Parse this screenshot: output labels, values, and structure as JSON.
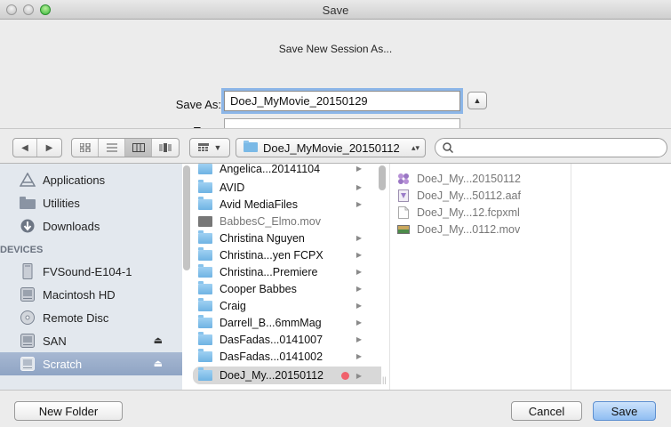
{
  "window": {
    "title": "Save"
  },
  "dialog": {
    "subtitle": "Save New Session As...",
    "save_as_label": "Save As:",
    "save_as_value": "DoeJ_MyMovie_20150129",
    "tags_label": "Tags:",
    "tags_value": ""
  },
  "toolbar": {
    "current_folder": "DoeJ_MyMovie_20150112",
    "search_placeholder": "",
    "active_view": "columns"
  },
  "sidebar": {
    "items_top": [
      {
        "label": "Applications",
        "icon": "applications-icon"
      },
      {
        "label": "Utilities",
        "icon": "folder-icon"
      },
      {
        "label": "Downloads",
        "icon": "downloads-icon"
      }
    ],
    "devices_heading": "DEVICES",
    "devices": [
      {
        "label": "FVSound-E104-1",
        "icon": "computer-icon",
        "eject": false
      },
      {
        "label": "Macintosh HD",
        "icon": "hard-drive-icon",
        "eject": false
      },
      {
        "label": "Remote Disc",
        "icon": "disc-icon",
        "eject": false
      },
      {
        "label": "SAN",
        "icon": "drive-icon",
        "eject": true
      },
      {
        "label": "Scratch",
        "icon": "drive-icon",
        "eject": true,
        "selected": true
      }
    ]
  },
  "column1": {
    "rows": [
      {
        "label": "Angelica...20141104",
        "type": "folder",
        "arrow": true
      },
      {
        "label": "AVID",
        "type": "folder",
        "arrow": true
      },
      {
        "label": "Avid MediaFiles",
        "type": "folder",
        "arrow": true
      },
      {
        "label": "BabbesC_Elmo.mov",
        "type": "file",
        "arrow": false
      },
      {
        "label": "Christina Nguyen",
        "type": "folder",
        "arrow": true
      },
      {
        "label": "Christina...yen FCPX",
        "type": "folder",
        "arrow": true
      },
      {
        "label": "Christina...Premiere",
        "type": "folder",
        "arrow": true
      },
      {
        "label": "Cooper Babbes",
        "type": "folder",
        "arrow": true
      },
      {
        "label": "Craig",
        "type": "folder",
        "arrow": true
      },
      {
        "label": "Darrell_B...6mmMag",
        "type": "folder",
        "arrow": true
      },
      {
        "label": "DasFadas...0141007",
        "type": "folder",
        "arrow": true
      },
      {
        "label": "DasFadas...0141002",
        "type": "folder",
        "arrow": true
      },
      {
        "label": "DoeJ_My...20150112",
        "type": "folder",
        "arrow": true,
        "selected": true,
        "tag": "red"
      }
    ]
  },
  "column2": {
    "rows": [
      {
        "label": "DoeJ_My...20150112",
        "icon": "project-icon"
      },
      {
        "label": "DoeJ_My...50112.aaf",
        "icon": "aaf-file-icon"
      },
      {
        "label": "DoeJ_My...12.fcpxml",
        "icon": "document-icon"
      },
      {
        "label": "DoeJ_My...0112.mov",
        "icon": "movie-file-icon"
      }
    ]
  },
  "footer": {
    "new_folder_label": "New Folder",
    "cancel_label": "Cancel",
    "save_label": "Save"
  },
  "colors": {
    "selection_sidebar": "#94a8c7",
    "focus_ring": "#8cb6e8",
    "tag_red": "#f0616c",
    "default_button": "#8fbdf2"
  }
}
